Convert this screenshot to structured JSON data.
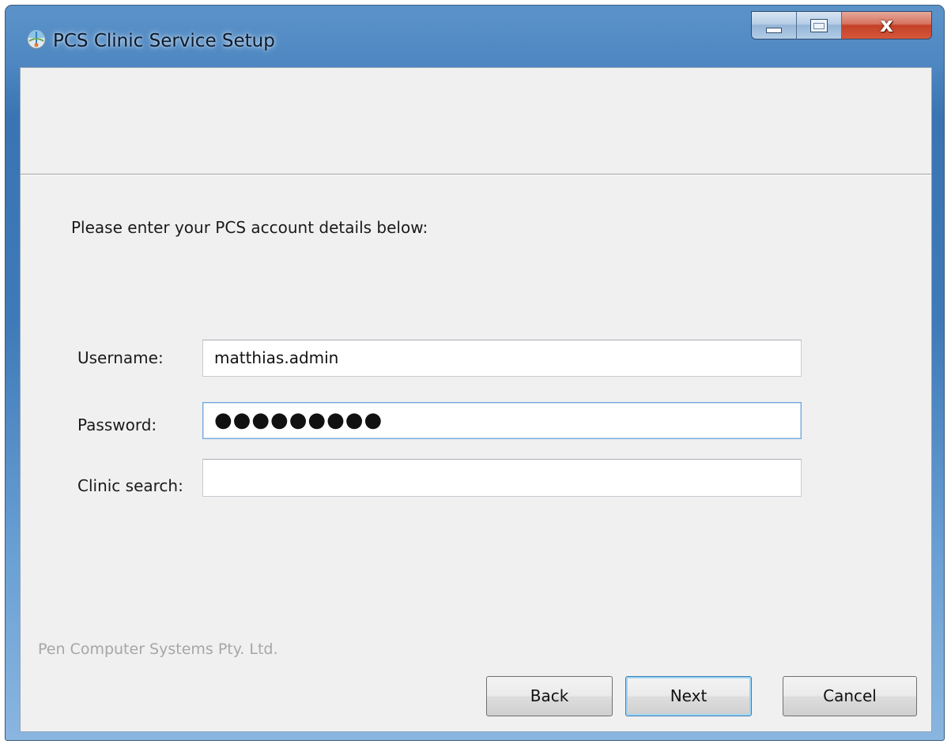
{
  "window": {
    "title": "PCS Clinic Service Setup",
    "caption_buttons": {
      "minimize_icon": "minimize-icon",
      "maximize_icon": "maximize-icon",
      "close_glyph": "x"
    }
  },
  "form": {
    "instruction": "Please enter your PCS account details below:",
    "username_label": "Username:",
    "username_value": "matthias.admin",
    "password_label": "Password:",
    "password_display": "●●●●●●●●●",
    "clinic_label": "Clinic search:",
    "clinic_value": ""
  },
  "footer": {
    "brand": "Pen Computer Systems Pty. Ltd.",
    "back_label": "Back",
    "next_label": "Next",
    "cancel_label": "Cancel"
  },
  "colors": {
    "titlebar_blue": "#4f88c2",
    "client_bg": "#f0f0f0",
    "focus_border": "#6fa8dc",
    "close_red": "#c34127"
  }
}
